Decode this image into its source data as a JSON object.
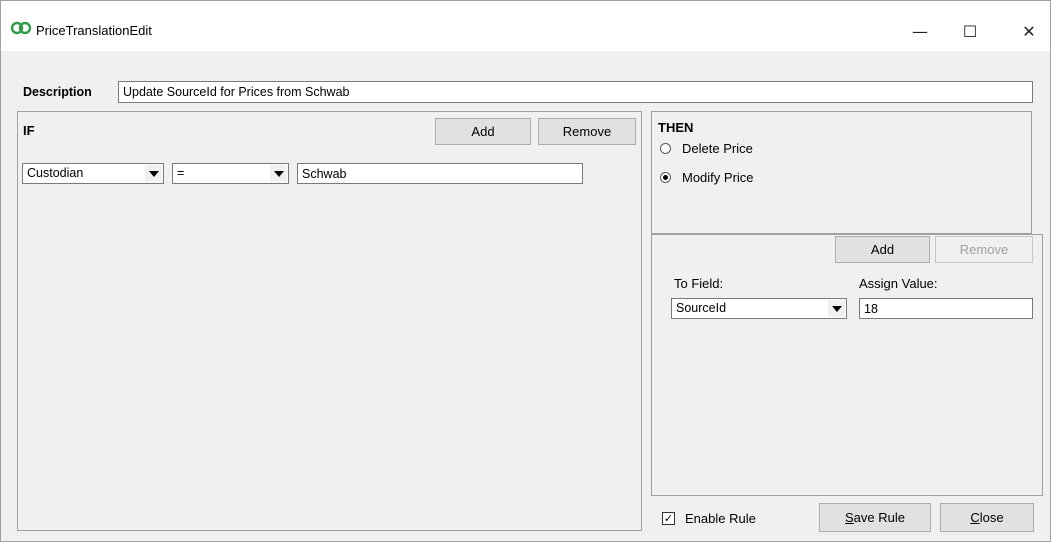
{
  "window": {
    "title": "PriceTranslationEdit",
    "controls": {
      "minimize": "—",
      "maximize": "☐",
      "close": "✕"
    }
  },
  "description": {
    "label": "Description",
    "value": "Update SourceId for Prices from Schwab"
  },
  "if_panel": {
    "label": "IF",
    "add_label": "Add",
    "remove_label": "Remove",
    "condition": {
      "field": "Custodian",
      "operator": "=",
      "value": "Schwab"
    }
  },
  "then_panel": {
    "label": "THEN",
    "options": [
      {
        "label": "Delete Price",
        "selected": false
      },
      {
        "label": "Modify Price",
        "selected": true
      }
    ]
  },
  "assign_panel": {
    "add_label": "Add",
    "remove_label": "Remove",
    "remove_disabled": true,
    "to_field_label": "To Field:",
    "to_field_value": "SourceId",
    "assign_value_label": "Assign Value:",
    "assign_value": "18"
  },
  "footer": {
    "enable_rule_label": "Enable Rule",
    "enable_rule_checked": true,
    "save_rule": {
      "mnemonic": "S",
      "rest": "ave Rule"
    },
    "close": {
      "mnemonic": "C",
      "rest": "lose"
    }
  },
  "colors": {
    "icon_green": "#2e9a44",
    "window_bg": "#f0f0f0",
    "button_bg": "#e1e1e1"
  }
}
